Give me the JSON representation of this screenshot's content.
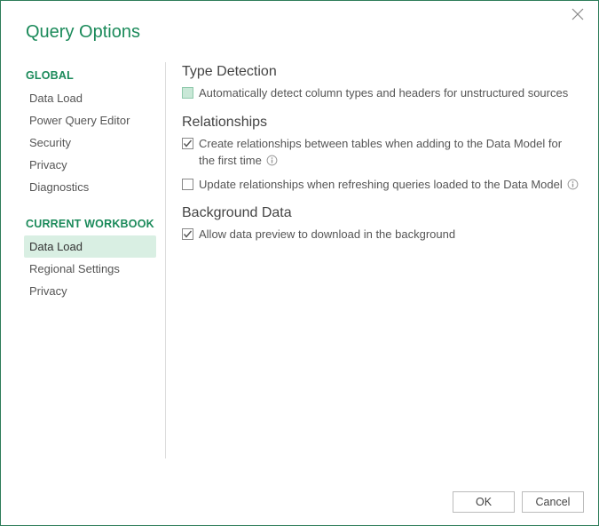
{
  "title": "Query Options",
  "sidebar": {
    "groups": [
      {
        "heading": "GLOBAL",
        "items": [
          {
            "label": "Data Load",
            "selected": false
          },
          {
            "label": "Power Query Editor",
            "selected": false
          },
          {
            "label": "Security",
            "selected": false
          },
          {
            "label": "Privacy",
            "selected": false
          },
          {
            "label": "Diagnostics",
            "selected": false
          }
        ]
      },
      {
        "heading": "CURRENT WORKBOOK",
        "items": [
          {
            "label": "Data Load",
            "selected": true
          },
          {
            "label": "Regional Settings",
            "selected": false
          },
          {
            "label": "Privacy",
            "selected": false
          }
        ]
      }
    ]
  },
  "content": {
    "sections": [
      {
        "heading": "Type Detection",
        "options": [
          {
            "label": "Automatically detect column types and headers for unstructured sources",
            "state": "mixed",
            "info": false
          }
        ]
      },
      {
        "heading": "Relationships",
        "options": [
          {
            "label": "Create relationships between tables when adding to the Data Model for the first time",
            "state": "checked",
            "info": true
          },
          {
            "label": "Update relationships when refreshing queries loaded to the Data Model",
            "state": "unchecked",
            "info": true
          }
        ]
      },
      {
        "heading": "Background Data",
        "options": [
          {
            "label": "Allow data preview to download in the background",
            "state": "checked",
            "info": false
          }
        ]
      }
    ]
  },
  "buttons": {
    "ok": "OK",
    "cancel": "Cancel"
  }
}
